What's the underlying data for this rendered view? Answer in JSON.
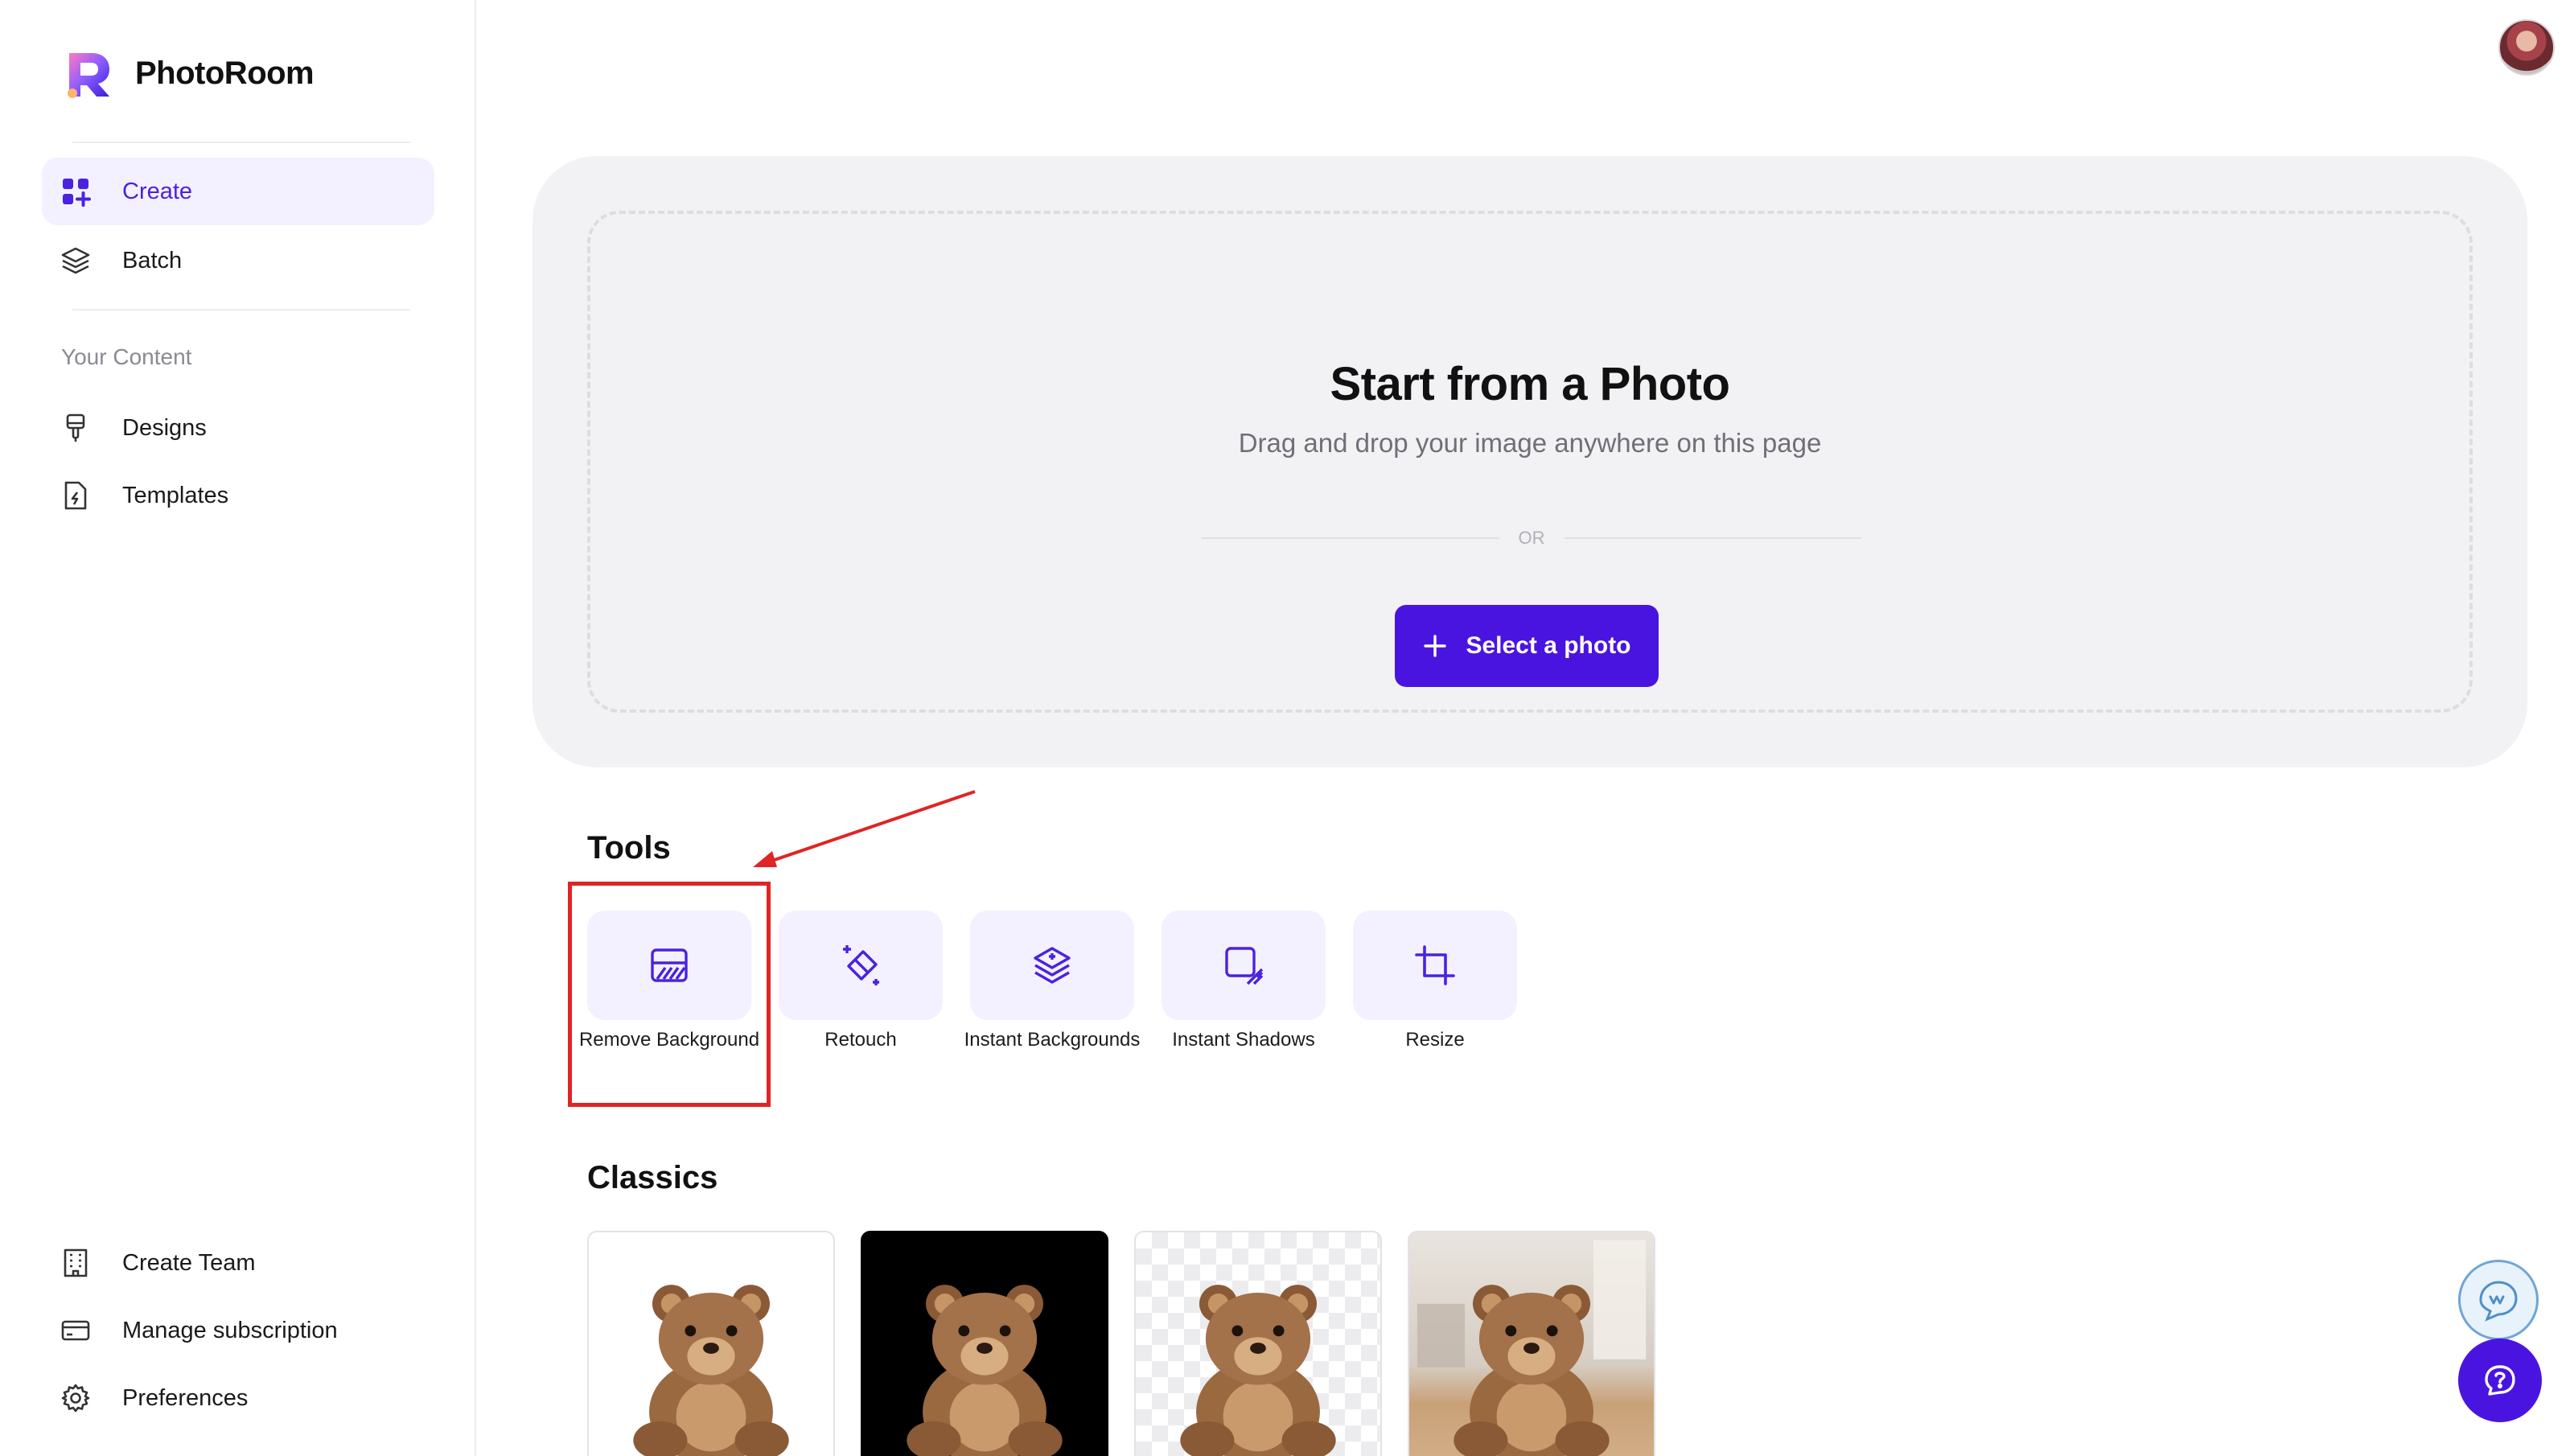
{
  "brand": {
    "name": "PhotoRoom",
    "logo_icon": "photoroom-logo-icon"
  },
  "sidebar": {
    "nav": [
      {
        "label": "Create",
        "icon": "grid-plus-icon",
        "active": true
      },
      {
        "label": "Batch",
        "icon": "layers-icon",
        "active": false
      }
    ],
    "section_label": "Your Content",
    "content_nav": [
      {
        "label": "Designs",
        "icon": "brush-icon"
      },
      {
        "label": "Templates",
        "icon": "file-bolt-icon"
      }
    ],
    "bottom_nav": [
      {
        "label": "Create Team",
        "icon": "building-icon"
      },
      {
        "label": "Manage subscription",
        "icon": "credit-card-icon"
      },
      {
        "label": "Preferences",
        "icon": "gear-icon"
      }
    ]
  },
  "upload": {
    "title": "Start from a Photo",
    "subtitle": "Drag and drop your image anywhere on this page",
    "or_text": "OR",
    "button_label": "Select a photo"
  },
  "tools": {
    "heading": "Tools",
    "items": [
      {
        "label": "Remove Background",
        "icon": "remove-background-icon"
      },
      {
        "label": "Retouch",
        "icon": "eraser-sparkle-icon"
      },
      {
        "label": "Instant Backgrounds",
        "icon": "layers-sparkle-icon"
      },
      {
        "label": "Instant Shadows",
        "icon": "shadow-square-icon"
      },
      {
        "label": "Resize",
        "icon": "crop-icon"
      }
    ]
  },
  "classics": {
    "heading": "Classics",
    "items": [
      {
        "background": "white"
      },
      {
        "background": "black"
      },
      {
        "background": "transparent"
      },
      {
        "background": "scene"
      }
    ]
  },
  "colors": {
    "accent": "#4a14e0",
    "accent_soft": "#f3f1ff",
    "panel": "#f2f2f5",
    "highlight": "#e02424"
  }
}
